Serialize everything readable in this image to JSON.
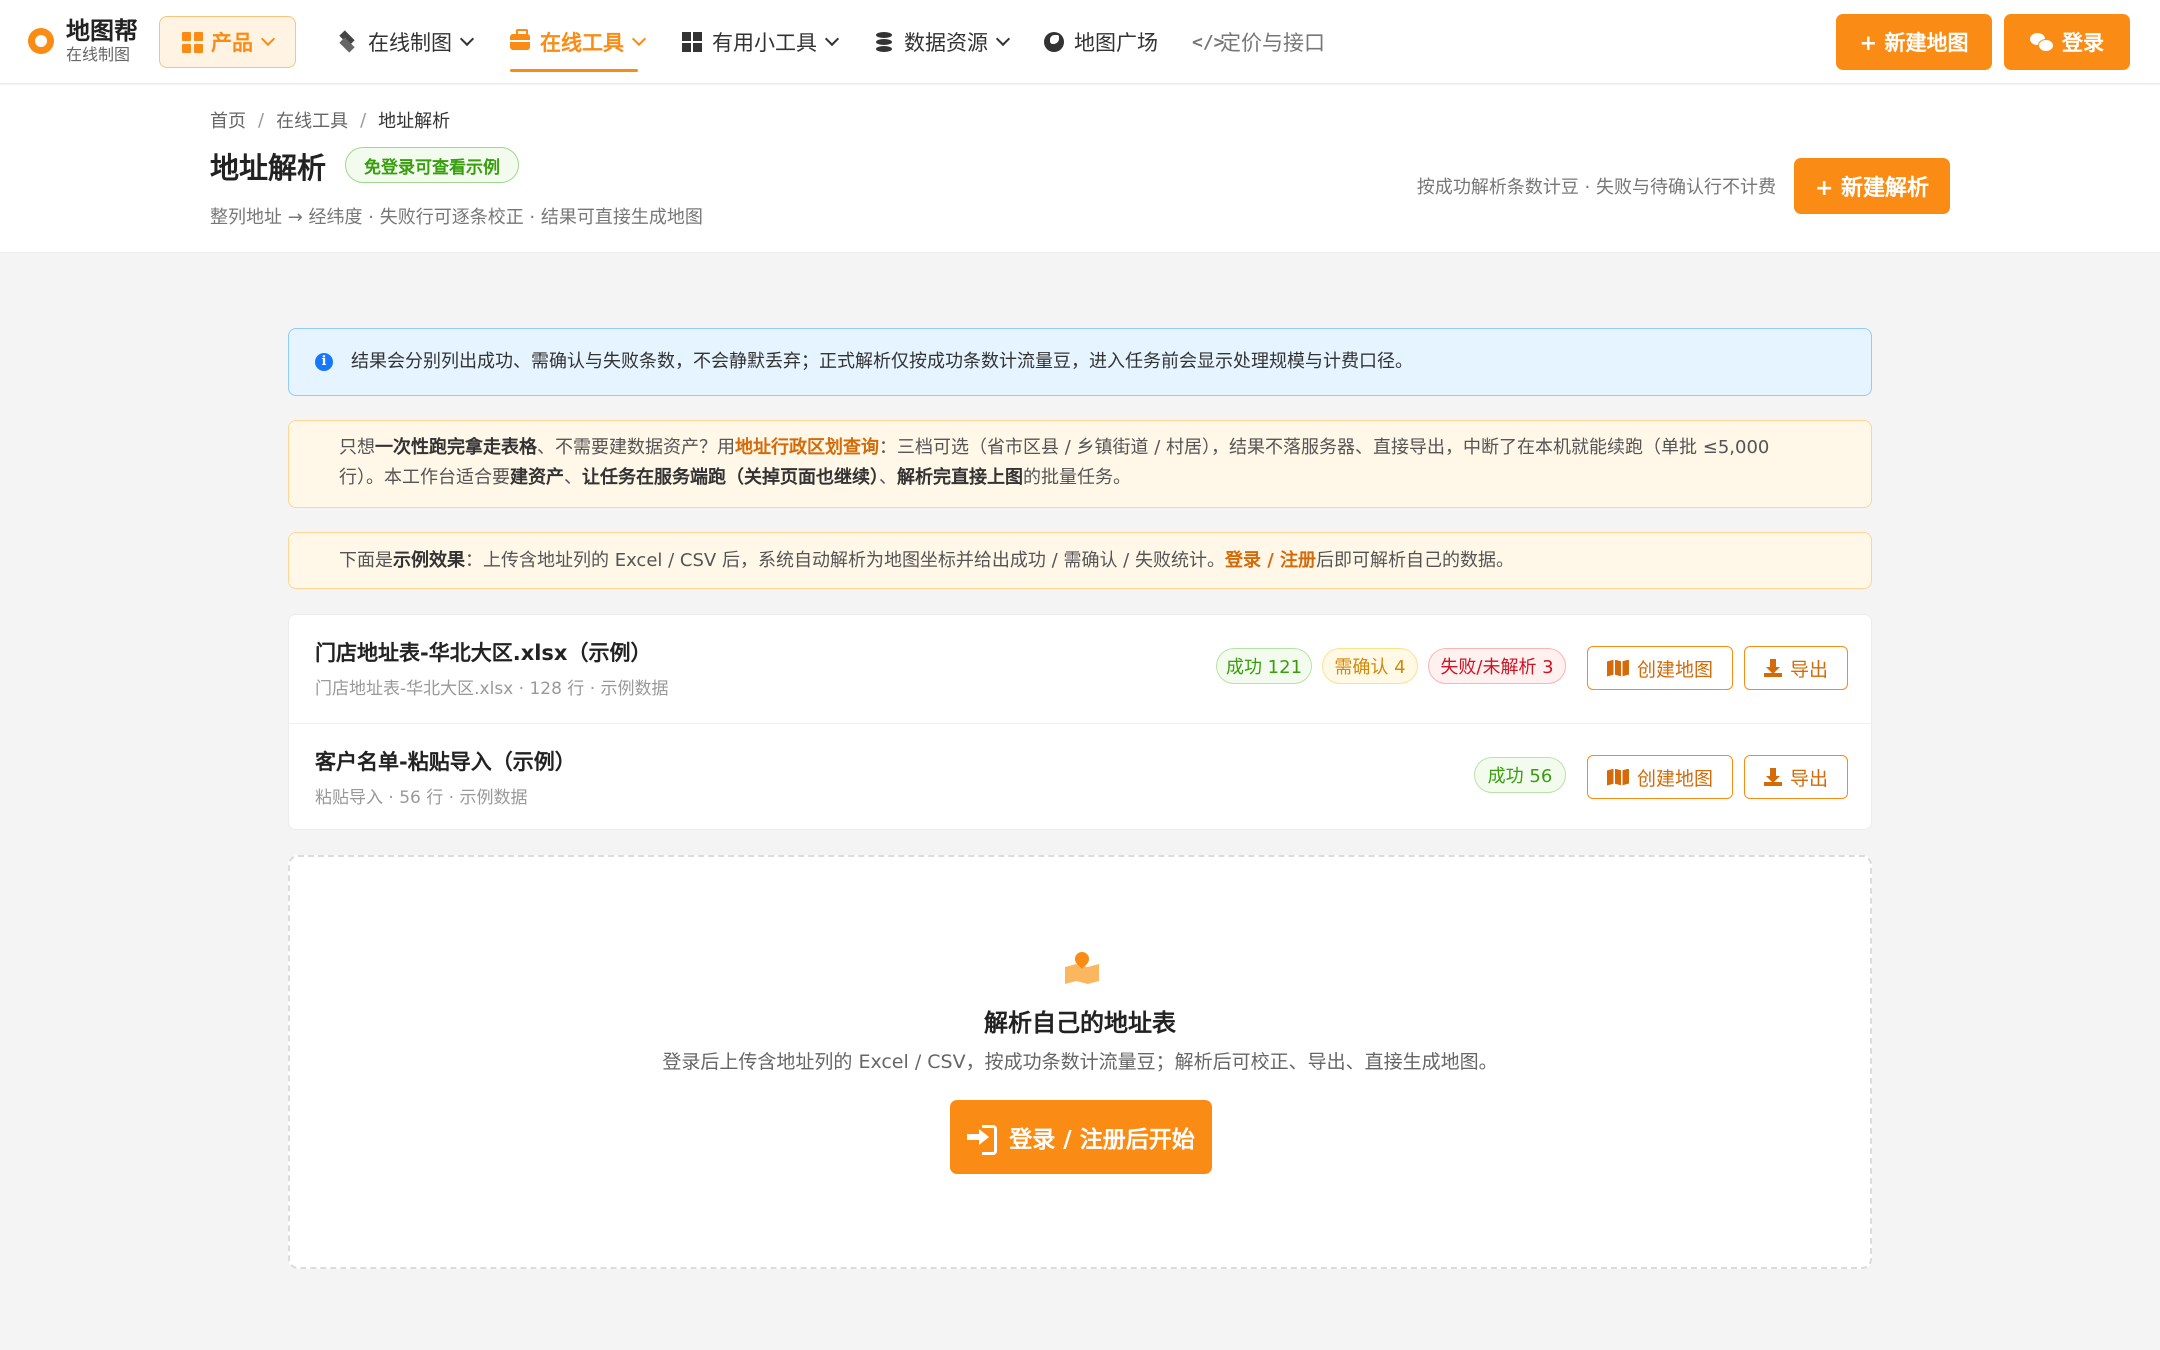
{
  "brand": {
    "title": "地图帮",
    "subtitle": "在线制图"
  },
  "nav": {
    "product": "产品",
    "items": [
      {
        "label": "在线制图",
        "icon": "layers-icon"
      },
      {
        "label": "在线工具",
        "icon": "toolbox-icon",
        "active": true
      },
      {
        "label": "有用小工具",
        "icon": "grid-icon"
      },
      {
        "label": "数据资源",
        "icon": "database-icon"
      },
      {
        "label": "地图广场",
        "icon": "globe-icon"
      },
      {
        "label": "定价与接口",
        "icon": "code-icon"
      }
    ],
    "new_map": "+ 新建地图",
    "login": "登录"
  },
  "breadcrumb": [
    "首页",
    "在线工具",
    "地址解析"
  ],
  "page": {
    "title": "地址解析",
    "badge": "免登录可查看示例",
    "subtitle": "整列地址 → 经纬度 · 失败行可逐条校正 · 结果可直接生成地图",
    "billing_note": "按成功解析条数计豆 · 失败与待确认行不计费",
    "new_button": "+ 新建解析"
  },
  "alerts": {
    "info": "结果会分别列出成功、需确认与失败条数，不会静默丢弃；正式解析仅按成功条数计流量豆，进入任务前会显示处理规模与计费口径。",
    "warn1": {
      "t1": "只想",
      "b1": "一次性跑完拿走表格",
      "t2": "、不需要建数据资产？用",
      "link": "地址行政区划查询",
      "t3": "：三档可选（省市区县 / 乡镇街道 / 村居），结果不落服务器、直接导出，中断了在本机就能续跑（单批 ≤5,000 行）。本工作台适合要",
      "b2": "建资产",
      "t4": "、",
      "b3": "让任务在服务端跑（关掉页面也继续）",
      "t5": "、",
      "b4": "解析完直接上图",
      "t6": "的批量任务。"
    },
    "warn2": {
      "t1": "下面是",
      "b1": "示例效果",
      "t2": "：上传含地址列的 Excel / CSV 后，系统自动解析为地图坐标并给出成功 / 需确认 / 失败统计。",
      "link": "登录 / 注册",
      "t3": "后即可解析自己的数据。"
    }
  },
  "tasks": [
    {
      "title": "门店地址表-华北大区.xlsx（示例）",
      "meta": "门店地址表-华北大区.xlsx · 128 行 · 示例数据",
      "ok": "成功 121",
      "warn": "需确认 4",
      "fail": "失败/未解析 3",
      "create": "创建地图",
      "export": "导出"
    },
    {
      "title": "客户名单-粘贴导入（示例）",
      "meta": "粘贴导入 · 56 行 · 示例数据",
      "ok": "成功 56",
      "create": "创建地图",
      "export": "导出"
    }
  ],
  "empty": {
    "title": "解析自己的地址表",
    "desc": "登录后上传含地址列的 Excel / CSV，按成功条数计流量豆；解析后可校正、导出、直接生成地图。",
    "cta": "登录 / 注册后开始"
  },
  "colors": {
    "accent": "#fa8c16",
    "success": "#389e0d",
    "warning": "#d48806",
    "danger": "#cf1322",
    "info": "#1677ff"
  }
}
